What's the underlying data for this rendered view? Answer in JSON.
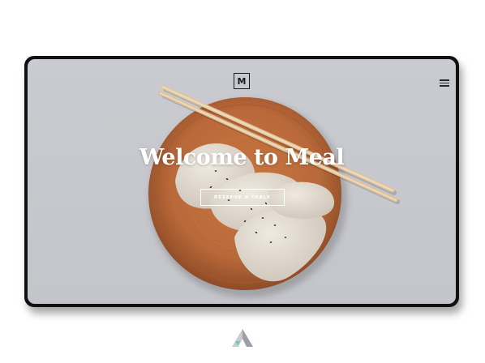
{
  "header": {
    "logo_letter": "M",
    "menu_icon": "hamburger-menu-icon"
  },
  "hero": {
    "title": "Welcome to Meal",
    "cta_label": "Reserve a Table",
    "image": "dumplings-on-wooden-plate-with-chopsticks"
  },
  "footer": {
    "brand_icon": "triangle-logo-icon"
  },
  "colors": {
    "background": "#ffffff",
    "frame": "#111111",
    "screen_bg": "#c6c8cd",
    "plate": "#b86a3c",
    "accent_teal": "#4fd1c5"
  }
}
